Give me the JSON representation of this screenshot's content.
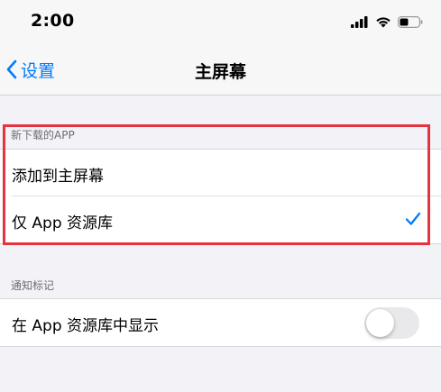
{
  "status_bar": {
    "time": "2:00"
  },
  "nav": {
    "back_label": "设置",
    "title": "主屏幕"
  },
  "sections": [
    {
      "header": "新下载的APP",
      "rows": [
        {
          "label": "添加到主屏幕",
          "selected": false
        },
        {
          "label": "仅 App 资源库",
          "selected": true
        }
      ]
    },
    {
      "header": "通知标记",
      "rows": [
        {
          "label": "在 App 资源库中显示",
          "toggle_on": false
        }
      ]
    }
  ],
  "colors": {
    "accent": "#007aff",
    "highlight": "#e63340",
    "background": "#f2f2f7"
  }
}
